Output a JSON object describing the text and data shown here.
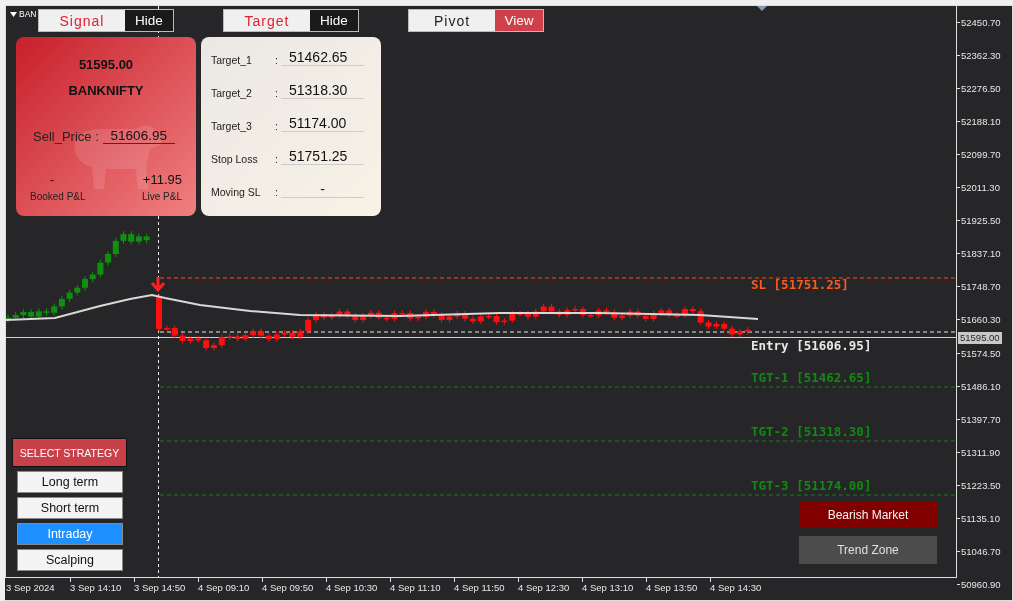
{
  "chart": {
    "symbol": "BAN",
    "price_axis": [
      "52450.70",
      "52362.30",
      "52276.50",
      "52188.10",
      "52099.70",
      "52011.30",
      "51925.50",
      "51837.10",
      "51748.70",
      "51660.30",
      "51574.50",
      "51486.10",
      "51397.70",
      "51311.90",
      "51223.50",
      "51135.10",
      "51046.70",
      "50960.90"
    ],
    "current_price": "51595.00",
    "time_axis": [
      "3 Sep 2024",
      "3 Sep 14:10",
      "3 Sep 14:50",
      "4 Sep 09:10",
      "4 Sep 09:50",
      "4 Sep 10:30",
      "4 Sep 11:10",
      "4 Sep 11:50",
      "4 Sep 12:30",
      "4 Sep 13:10",
      "4 Sep 13:50",
      "4 Sep 14:30"
    ],
    "levels": [
      {
        "kind": "sl",
        "label": "SL [51751.25]"
      },
      {
        "kind": "entry",
        "label": "Entry [51606.95]"
      },
      {
        "kind": "target",
        "label": "TGT-1 [51462.65]"
      },
      {
        "kind": "target",
        "label": "TGT-2 [51318.30]"
      },
      {
        "kind": "target",
        "label": "TGT-3 [51174.00]"
      }
    ]
  },
  "toggles": [
    {
      "label": "Signal",
      "button": "Hide",
      "visible": true
    },
    {
      "label": "Target",
      "button": "Hide",
      "visible": true
    },
    {
      "label": "Pivot",
      "button": "View",
      "visible": false
    }
  ],
  "signal_panel": {
    "price": "51595.00",
    "symbol": "BANKNIFTY",
    "sell_label": "Sell_Price :",
    "sell_price": "51606.95",
    "booked_pnl": "-",
    "live_pnl": "+11.95",
    "booked_label": "Booked P&L",
    "live_label": "Live P&L"
  },
  "target_panel": {
    "rows": [
      {
        "label": "Target_1",
        "separator": ":",
        "value": "51462.65"
      },
      {
        "label": "Target_2",
        "separator": ":",
        "value": "51318.30"
      },
      {
        "label": "Target_3",
        "separator": ":",
        "value": "51174.00"
      },
      {
        "label": "Stop Loss",
        "separator": ":",
        "value": "51751.25"
      },
      {
        "label": "Moving SL",
        "separator": ":",
        "value": "-"
      }
    ]
  },
  "strategy": {
    "title": "SELECT STRATEGY",
    "options": [
      {
        "label": "Long term",
        "selected": false
      },
      {
        "label": "Short term",
        "selected": false
      },
      {
        "label": "Intraday",
        "selected": true
      },
      {
        "label": "Scalping",
        "selected": false
      }
    ]
  },
  "market": {
    "trend": "Bearish Market",
    "zone": "Trend Zone"
  }
}
